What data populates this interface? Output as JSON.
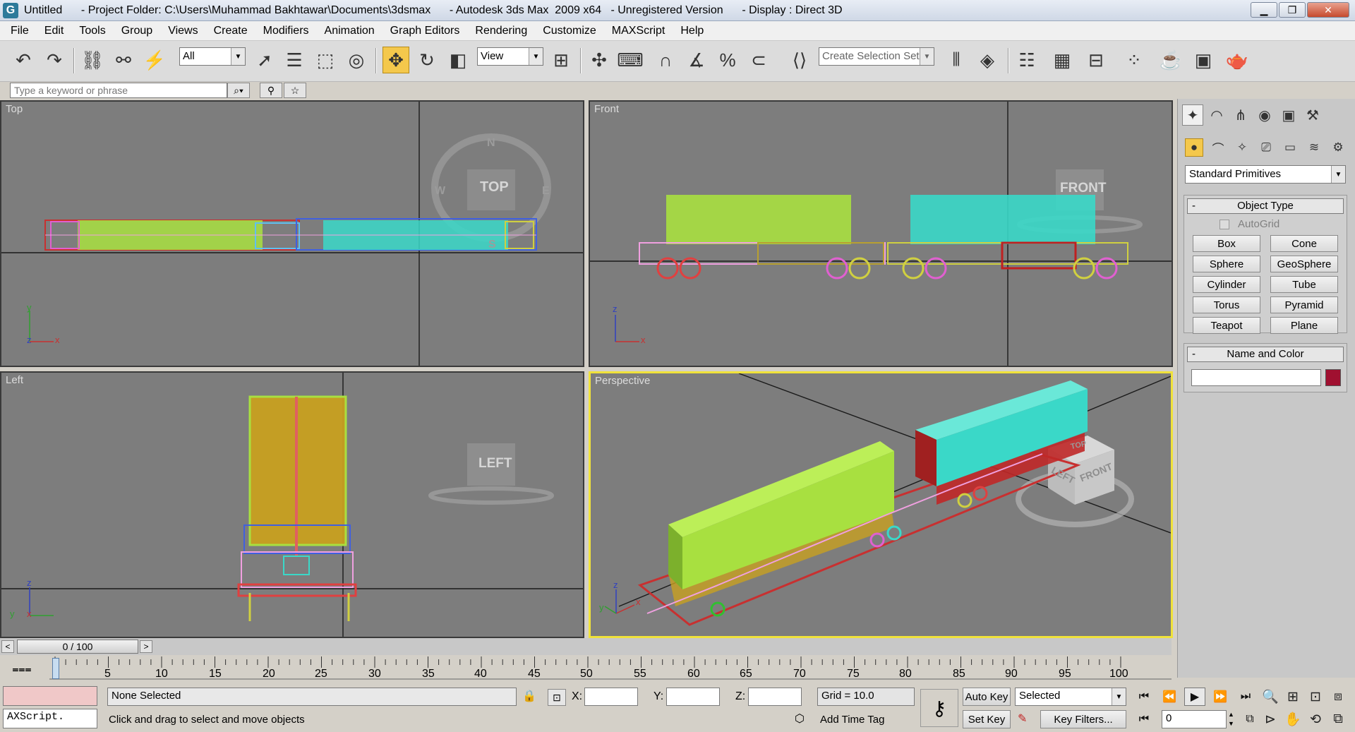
{
  "window": {
    "title": "Untitled      - Project Folder: C:\\Users\\Muhammad Bakhtawar\\Documents\\3dsmax      - Autodesk 3ds Max  2009 x64   - Unregistered Version      - Display : Direct 3D"
  },
  "menu": [
    "File",
    "Edit",
    "Tools",
    "Group",
    "Views",
    "Create",
    "Modifiers",
    "Animation",
    "Graph Editors",
    "Rendering",
    "Customize",
    "MAXScript",
    "Help"
  ],
  "toolbar": {
    "filter_value": "All",
    "refcoord_value": "View",
    "selection_set_placeholder": "Create Selection Set"
  },
  "search": {
    "placeholder": "Type a keyword or phrase"
  },
  "viewports": {
    "top": {
      "label": "Top",
      "gizmo": "TOP"
    },
    "front": {
      "label": "Front",
      "gizmo": "FRONT"
    },
    "left": {
      "label": "Left",
      "gizmo": "LEFT"
    },
    "perspective": {
      "label": "Perspective",
      "gizmo_top": "TOP",
      "gizmo_left": "LEFT",
      "gizmo_front": "FRONT"
    }
  },
  "compass": {
    "n": "N",
    "w": "W",
    "e": "E",
    "s": "S"
  },
  "axes": {
    "x": "x",
    "y": "y",
    "z": "z"
  },
  "command_panel": {
    "category": "Standard Primitives",
    "object_type": {
      "title": "Object Type",
      "autogrid": "AutoGrid",
      "buttons": [
        "Box",
        "Cone",
        "Sphere",
        "GeoSphere",
        "Cylinder",
        "Tube",
        "Torus",
        "Pyramid",
        "Teapot",
        "Plane"
      ]
    },
    "name_color": {
      "title": "Name and Color",
      "name_value": "",
      "color": "#a01030"
    },
    "minus": "-"
  },
  "timeline": {
    "frame_display": "0 / 100",
    "ticks": [
      "5",
      "10",
      "15",
      "20",
      "25",
      "30",
      "35",
      "40",
      "45",
      "50",
      "55",
      "60",
      "65",
      "70",
      "75",
      "80",
      "85",
      "90",
      "95",
      "100"
    ]
  },
  "status": {
    "selection": "None Selected",
    "prompt": "Click and drag to select and move objects",
    "maxscript": "AXScript.",
    "x_label": "X:",
    "y_label": "Y:",
    "z_label": "Z:",
    "grid": "Grid = 10.0",
    "add_time_tag": "Add Time Tag",
    "auto_key": "Auto Key",
    "set_key": "Set Key",
    "key_mode_value": "Selected",
    "key_filters": "Key Filters...",
    "current_frame": "0"
  },
  "colors": {
    "accent_yellow": "#f4c84c",
    "viewport_bg": "#7d7d7d",
    "active_border": "#f0e23a",
    "container_green": "#a8e040",
    "container_cyan": "#3ad8c8"
  }
}
